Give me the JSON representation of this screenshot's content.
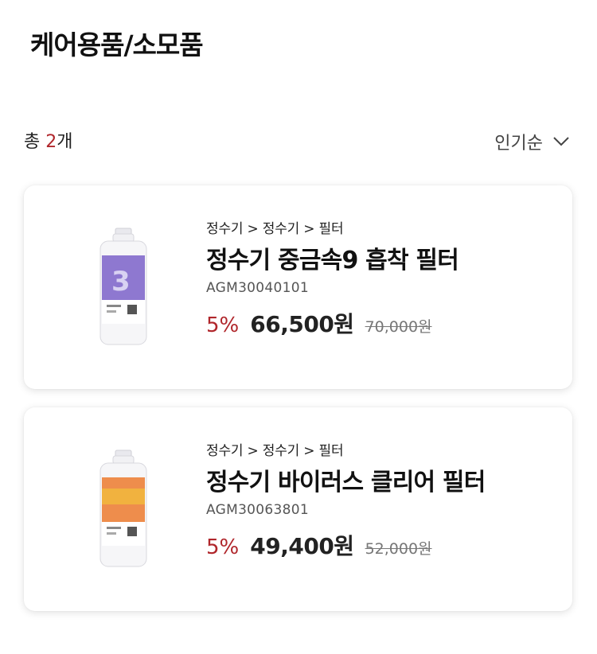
{
  "header": {
    "title": "케어용품/소모품"
  },
  "toolbar": {
    "total_prefix": "총",
    "total_count": "2",
    "total_suffix": "개",
    "sort_label": "인기순"
  },
  "products": [
    {
      "breadcrumb": "정수기 > 정수기 > 필터",
      "name": "정수기 중금속9 흡착 필터",
      "code": "AGM30040101",
      "discount": "5%",
      "price": "66,500원",
      "original_price": "70,000원",
      "label_color": "#7b62c9"
    },
    {
      "breadcrumb": "정수기 > 정수기 > 필터",
      "name": "정수기 바이러스 클리어 필터",
      "code": "AGM30063801",
      "discount": "5%",
      "price": "49,400원",
      "original_price": "52,000원",
      "label_color": "#ec7a2e"
    }
  ],
  "colors": {
    "accent": "#b0262b"
  }
}
